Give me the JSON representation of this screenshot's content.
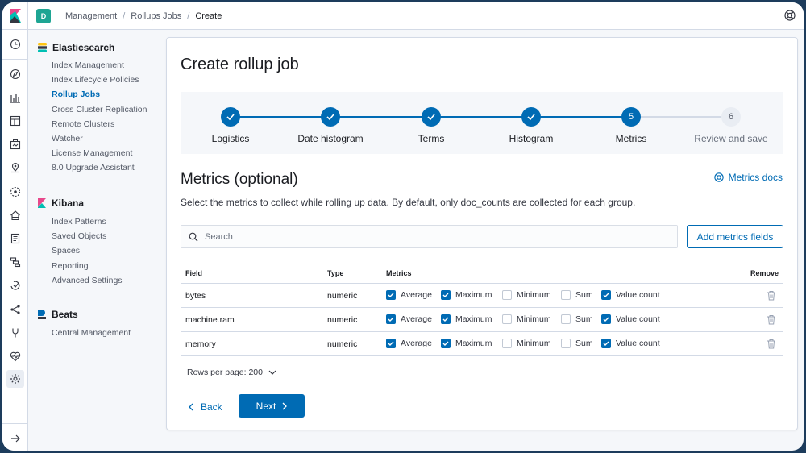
{
  "header": {
    "space_initial": "D",
    "breadcrumbs": [
      "Management",
      "Rollups Jobs",
      "Create"
    ]
  },
  "sidenav": {
    "groups": [
      {
        "title": "Elasticsearch",
        "items": [
          {
            "label": "Index Management",
            "active": false
          },
          {
            "label": "Index Lifecycle Policies",
            "active": false
          },
          {
            "label": "Rollup Jobs",
            "active": true
          },
          {
            "label": "Cross Cluster Replication",
            "active": false
          },
          {
            "label": "Remote Clusters",
            "active": false
          },
          {
            "label": "Watcher",
            "active": false
          },
          {
            "label": "License Management",
            "active": false
          },
          {
            "label": "8.0 Upgrade Assistant",
            "active": false
          }
        ]
      },
      {
        "title": "Kibana",
        "items": [
          {
            "label": "Index Patterns",
            "active": false
          },
          {
            "label": "Saved Objects",
            "active": false
          },
          {
            "label": "Spaces",
            "active": false
          },
          {
            "label": "Reporting",
            "active": false
          },
          {
            "label": "Advanced Settings",
            "active": false
          }
        ]
      },
      {
        "title": "Beats",
        "items": [
          {
            "label": "Central Management",
            "active": false
          }
        ]
      }
    ]
  },
  "main": {
    "title": "Create rollup job",
    "steps": [
      {
        "label": "Logistics",
        "state": "done",
        "number": "1"
      },
      {
        "label": "Date histogram",
        "state": "done",
        "number": "2"
      },
      {
        "label": "Terms",
        "state": "done",
        "number": "3"
      },
      {
        "label": "Histogram",
        "state": "done",
        "number": "4"
      },
      {
        "label": "Metrics",
        "state": "current",
        "number": "5"
      },
      {
        "label": "Review and save",
        "state": "todo",
        "number": "6"
      }
    ],
    "section_title": "Metrics (optional)",
    "docs_link": "Metrics docs",
    "description": "Select the metrics to collect while rolling up data. By default, only doc_counts are collected for each group.",
    "search_placeholder": "Search",
    "add_button": "Add metrics fields",
    "table": {
      "headers": {
        "field": "Field",
        "type": "Type",
        "metrics": "Metrics",
        "remove": "Remove"
      },
      "metric_names": [
        "Average",
        "Maximum",
        "Minimum",
        "Sum",
        "Value count"
      ],
      "rows": [
        {
          "field": "bytes",
          "type": "numeric",
          "checked": [
            true,
            true,
            false,
            false,
            true
          ]
        },
        {
          "field": "machine.ram",
          "type": "numeric",
          "checked": [
            true,
            true,
            false,
            false,
            true
          ]
        },
        {
          "field": "memory",
          "type": "numeric",
          "checked": [
            true,
            true,
            false,
            false,
            true
          ]
        }
      ]
    },
    "rows_per_page": "Rows per page: 200",
    "back_button": "Back",
    "next_button": "Next"
  },
  "colors": {
    "primary": "#006bb4",
    "space_avatar": "#1ea593",
    "kibana_pink": "#e8488b",
    "elastic_yellow": "#fec514",
    "elastic_teal": "#00bfb3"
  }
}
